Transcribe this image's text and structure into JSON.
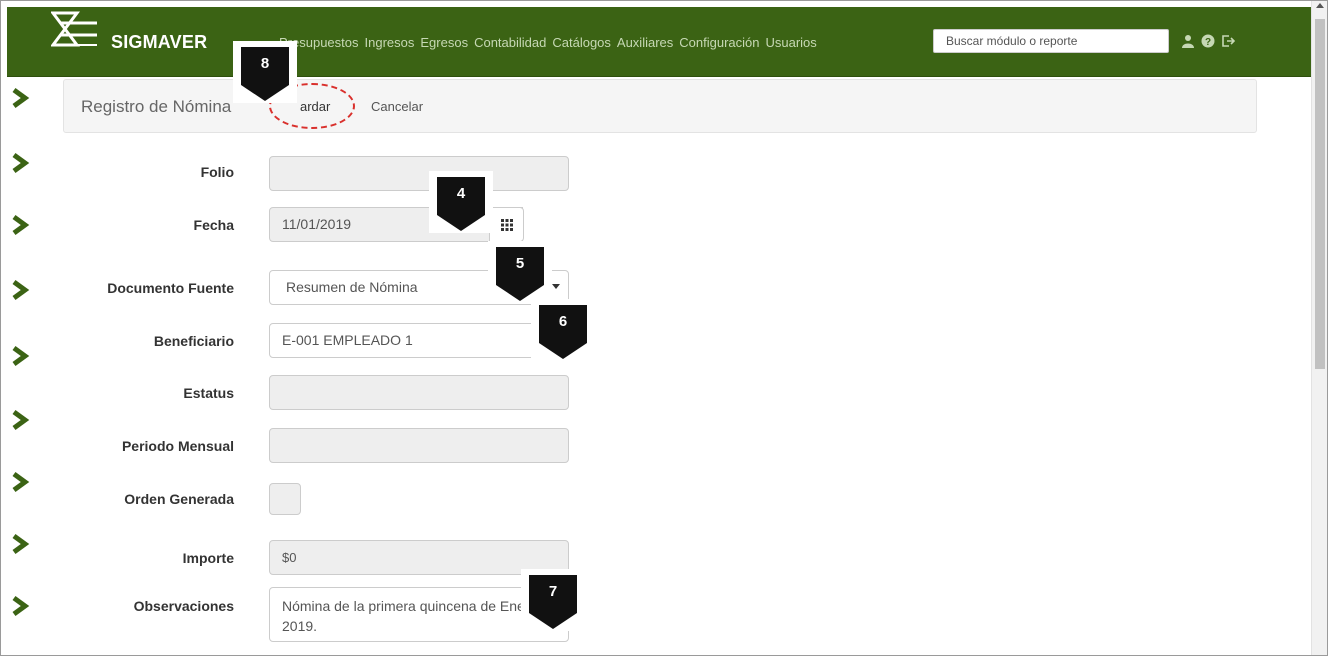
{
  "app": {
    "brand": "SIGMAVER"
  },
  "nav": {
    "items": [
      {
        "label": "Presupuestos"
      },
      {
        "label": "Ingresos"
      },
      {
        "label": "Egresos"
      },
      {
        "label": "Contabilidad"
      },
      {
        "label": "Catálogos"
      },
      {
        "label": "Auxiliares"
      },
      {
        "label": "Configuración"
      },
      {
        "label": "Usuarios"
      }
    ],
    "search_placeholder": "Buscar módulo o reporte",
    "icons": [
      "user-icon",
      "help-icon",
      "logout-icon"
    ]
  },
  "header": {
    "title": "Registro de Nómina",
    "save_label": "ardar",
    "cancel_label": "Cancelar"
  },
  "form": {
    "folio": {
      "label": "Folio",
      "value": ""
    },
    "fecha": {
      "label": "Fecha",
      "value": "11/01/2019"
    },
    "documento_fuente": {
      "label": "Documento Fuente",
      "value": "Resumen de Nómina"
    },
    "beneficiario": {
      "label": "Beneficiario",
      "value": "E-001 EMPLEADO 1"
    },
    "estatus": {
      "label": "Estatus",
      "value": ""
    },
    "periodo_mensual": {
      "label": "Periodo Mensual",
      "value": ""
    },
    "orden_generada": {
      "label": "Orden Generada",
      "checked": false
    },
    "importe": {
      "label": "Importe",
      "value": "$0"
    },
    "observaciones": {
      "label": "Observaciones",
      "value": "Nómina de la primera quincena de Enero 2019."
    }
  },
  "markers": [
    "8",
    "4",
    "5",
    "6",
    "7"
  ],
  "colors": {
    "navbar": "#3b6314",
    "nav_text": "#c6d8b4",
    "rail_arrow": "#3b6314",
    "highlight_ring": "#d9302c",
    "marker": "#111111"
  }
}
